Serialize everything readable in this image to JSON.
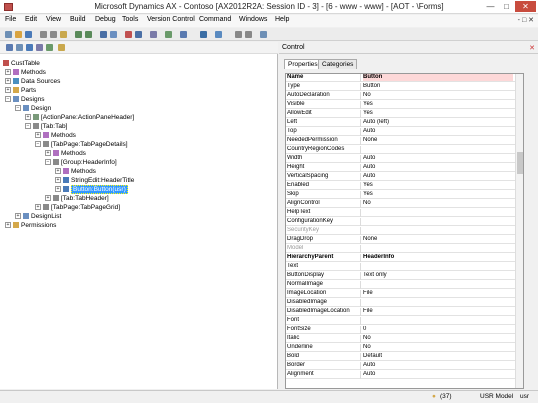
{
  "window": {
    "title": "Microsoft Dynamics AX - Contoso [AX2012R2A: Session ID - 3] - [6 - www - www] - [AOT - \\Forms]",
    "minimize": "—",
    "maximize": "□",
    "close": "✕"
  },
  "menu": {
    "items": [
      "File",
      "Edit",
      "View",
      "Build",
      "Debug",
      "Tools",
      "Version Control",
      "Command",
      "Windows",
      "Help"
    ],
    "right": "- □ ✕"
  },
  "tree": {
    "root": "CustTable",
    "nodes": [
      {
        "label": "Methods",
        "icon": "methods-icon"
      },
      {
        "label": "Data Sources",
        "icon": "datasources-icon"
      },
      {
        "label": "Parts",
        "icon": "parts-icon"
      },
      {
        "label": "Designs",
        "icon": "designs-icon"
      },
      {
        "label": "Design",
        "icon": "design-icon"
      },
      {
        "label": "[ActionPane:ActionPaneHeader]",
        "icon": "actionpane-icon"
      },
      {
        "label": "[Tab:Tab]",
        "icon": "tab-icon"
      },
      {
        "label": "Methods",
        "icon": "methods-icon"
      },
      {
        "label": "[TabPage:TabPageDetails]",
        "icon": "tabpage-icon"
      },
      {
        "label": "Methods",
        "icon": "methods-icon"
      },
      {
        "label": "[Group:HeaderInfo]",
        "icon": "group-icon"
      },
      {
        "label": "Methods",
        "icon": "methods-icon"
      },
      {
        "label": "StringEdit:HeaderTitle",
        "icon": "stringedit-icon"
      },
      {
        "label": "Button:Button(usr)",
        "icon": "button-icon"
      },
      {
        "label": "[Tab:TabHeader]",
        "icon": "tab-icon"
      },
      {
        "label": "[TabPage:TabPageGrid]",
        "icon": "tabpage-icon"
      },
      {
        "label": "DesignList",
        "icon": "designlist-icon"
      },
      {
        "label": "Permissions",
        "icon": "permissions-icon"
      }
    ]
  },
  "properties": {
    "title": "Control",
    "close": "✕",
    "tabs": [
      "Properties",
      "Categories"
    ],
    "rows": [
      {
        "name": "Name",
        "value": "Button",
        "kind": "hdr"
      },
      {
        "name": "Type",
        "value": "Button"
      },
      {
        "name": "AutoDeclaration",
        "value": "No"
      },
      {
        "name": "Visible",
        "value": "Yes"
      },
      {
        "name": "AllowEdit",
        "value": "Yes"
      },
      {
        "name": "Left",
        "value": "Auto (left)"
      },
      {
        "name": "Top",
        "value": "Auto"
      },
      {
        "name": "NeededPermission",
        "value": "None"
      },
      {
        "name": "CountryRegionCodes",
        "value": "",
        "kind": "hl"
      },
      {
        "name": "Width",
        "value": "Auto"
      },
      {
        "name": "Height",
        "value": "Auto"
      },
      {
        "name": "VerticalSpacing",
        "value": "Auto"
      },
      {
        "name": "Enabled",
        "value": "Yes"
      },
      {
        "name": "Skip",
        "value": "Yes"
      },
      {
        "name": "AlignControl",
        "value": "No"
      },
      {
        "name": "HelpText",
        "value": "",
        "kind": "hl"
      },
      {
        "name": "ConfigurationKey",
        "value": ""
      },
      {
        "name": "SecurityKey",
        "value": "",
        "kind": "dis"
      },
      {
        "name": "DragDrop",
        "value": "None"
      },
      {
        "name": "Model",
        "value": "",
        "kind": "dis"
      },
      {
        "name": "HierarchyParent",
        "value": "HeaderInfo",
        "kind": "bold"
      },
      {
        "name": "Text",
        "value": "",
        "kind": "hl"
      },
      {
        "name": "ButtonDisplay",
        "value": "Text only"
      },
      {
        "name": "NormalImage",
        "value": ""
      },
      {
        "name": "ImageLocation",
        "value": "File"
      },
      {
        "name": "DisabledImage",
        "value": ""
      },
      {
        "name": "DisabledImageLocation",
        "value": "File"
      },
      {
        "name": "Font",
        "value": ""
      },
      {
        "name": "FontSize",
        "value": "0"
      },
      {
        "name": "Italic",
        "value": "No"
      },
      {
        "name": "Underline",
        "value": "No"
      },
      {
        "name": "Bold",
        "value": "Default"
      },
      {
        "name": "Border",
        "value": "Auto"
      },
      {
        "name": "Alignment",
        "value": "Auto"
      }
    ]
  },
  "status": {
    "notifications": "(37)",
    "model": "USR Model",
    "user": "usr"
  }
}
